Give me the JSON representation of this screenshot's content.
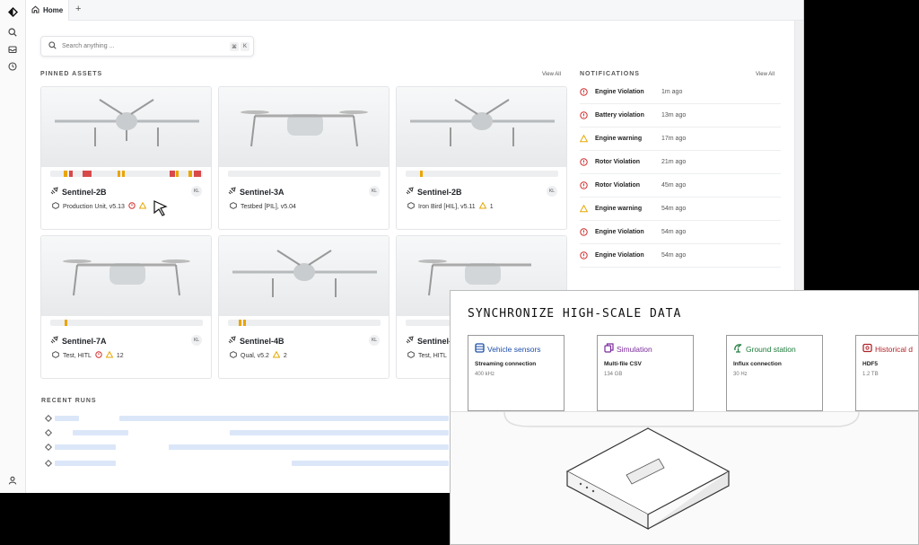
{
  "tabs": {
    "home_label": "Home",
    "add_label": "+"
  },
  "search": {
    "placeholder": "Search anything ...",
    "shortcut_mod": "⌘",
    "shortcut_key": "K"
  },
  "pinned": {
    "title": "PINNED ASSETS",
    "view_all": "View All",
    "cards": [
      {
        "name": "Sentinel-2B",
        "initials": "KL",
        "meta": "Production Unit, v5.13",
        "alert_count": ""
      },
      {
        "name": "Sentinel-3A",
        "initials": "KL",
        "meta": "Testbed [PIL], v5.04",
        "alert_count": ""
      },
      {
        "name": "Sentinel-2B",
        "initials": "KL",
        "meta": "Iron Bird [HIL], v5.11",
        "alert_count": "1"
      },
      {
        "name": "Sentinel-7A",
        "initials": "KL",
        "meta": "Test, HITL",
        "alert_count": "12"
      },
      {
        "name": "Sentinel-4B",
        "initials": "KL",
        "meta": "Qual, v5.2",
        "alert_count": "2"
      },
      {
        "name": "Sentinel-",
        "initials": "KL",
        "meta": "Test, HITL",
        "alert_count": ""
      }
    ]
  },
  "notifications": {
    "title": "NOTIFICATIONS",
    "view_all": "View All",
    "items": [
      {
        "label": "Engine Violation",
        "time": "1m ago",
        "level": "error"
      },
      {
        "label": "Battery violation",
        "time": "13m ago",
        "level": "error"
      },
      {
        "label": "Engine warning",
        "time": "17m ago",
        "level": "warning"
      },
      {
        "label": "Rotor Violation",
        "time": "21m ago",
        "level": "error"
      },
      {
        "label": "Rotor Violation",
        "time": "45m ago",
        "level": "error"
      },
      {
        "label": "Engine warning",
        "time": "54m ago",
        "level": "warning"
      },
      {
        "label": "Engine Violation",
        "time": "54m ago",
        "level": "error"
      },
      {
        "label": "Engine Violation",
        "time": "54m ago",
        "level": "error"
      }
    ]
  },
  "recent_runs": {
    "title": "RECENT RUNS"
  },
  "overlay": {
    "title": "SYNCHRONIZE HIGH-SCALE DATA",
    "sources": [
      {
        "title": "Vehicle sensors",
        "subtitle": "Streaming connection",
        "value": "400 kHz",
        "color": "#1f4fa8",
        "icon": "database-icon"
      },
      {
        "title": "Simulation",
        "subtitle": "Multi-file CSV",
        "value": "134 GB",
        "color": "#7a2a9c",
        "icon": "files-icon"
      },
      {
        "title": "Ground station",
        "subtitle": "Influx connection",
        "value": "30 Hz",
        "color": "#1d7a3a",
        "icon": "ground-station-icon"
      },
      {
        "title": "Historical d",
        "subtitle": "HDF5",
        "value": "1.2 TB",
        "color": "#b0242a",
        "icon": "archive-icon"
      }
    ]
  },
  "colors": {
    "error": "#d32f2f",
    "warning": "#e6a700",
    "link_bar": "#dbe7f8"
  }
}
